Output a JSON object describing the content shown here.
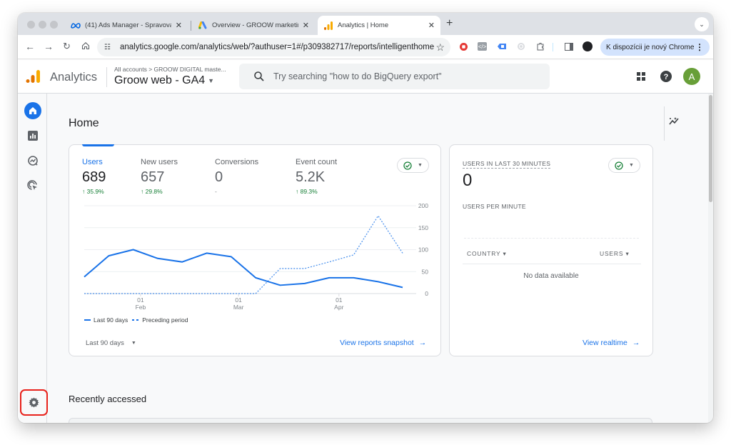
{
  "browser": {
    "tabs": [
      {
        "label": "(41) Ads Manager - Spravova",
        "icon": "meta-icon",
        "active": false
      },
      {
        "label": "Overview - GROOW marketing",
        "icon": "google-ads-icon",
        "active": false
      },
      {
        "label": "Analytics | Home",
        "icon": "analytics-icon",
        "active": true
      }
    ],
    "new_tab_label": "+",
    "url": "analytics.google.com/analytics/web/?authuser=1#/p309382717/reports/intelligenthome",
    "update_label": "K dispozícii je nový Chrome"
  },
  "header": {
    "app_name": "Analytics",
    "breadcrumb": "All accounts > GROOW DIGITAL maste...",
    "property": "Groow web - GA4",
    "search_placeholder": "Try searching \"how to do BigQuery export\"",
    "avatar_letter": "A"
  },
  "nav": {
    "items": [
      {
        "name": "home",
        "active": true
      },
      {
        "name": "reports",
        "active": false
      },
      {
        "name": "explore",
        "active": false
      },
      {
        "name": "advertising",
        "active": false
      }
    ],
    "settings_label": "Admin"
  },
  "main": {
    "title": "Home",
    "overview": {
      "metrics": [
        {
          "label": "Users",
          "value": "689",
          "change": "↑ 35.9%",
          "active": true
        },
        {
          "label": "New users",
          "value": "657",
          "change": "↑ 29.8%",
          "active": false
        },
        {
          "label": "Conversions",
          "value": "0",
          "change": "-",
          "active": false
        },
        {
          "label": "Event count",
          "value": "5.2K",
          "change": "↑ 89.3%",
          "active": false
        }
      ],
      "legend": {
        "current": "Last 90 days",
        "previous": "Preceding period"
      },
      "range": "Last 90 days",
      "link": "View reports snapshot",
      "link_arrow": "→"
    },
    "realtime": {
      "title": "USERS IN LAST 30 MINUTES",
      "value": "0",
      "subtitle": "USERS PER MINUTE",
      "col_country": "COUNTRY ▾",
      "col_users": "USERS ▾",
      "empty": "No data available",
      "link": "View realtime",
      "link_arrow": "→"
    },
    "recent_title": "Recently accessed"
  },
  "chart_data": {
    "type": "line",
    "title": "Users",
    "x_tick_labels": [
      {
        "day": "01",
        "month": "Feb",
        "index": 2.3
      },
      {
        "day": "01",
        "month": "Mar",
        "index": 6.3
      },
      {
        "day": "01",
        "month": "Apr",
        "index": 10.4
      }
    ],
    "y_ticks": [
      0,
      50,
      100,
      150,
      200
    ],
    "ylim": [
      0,
      200
    ],
    "series": [
      {
        "name": "Last 90 days",
        "style": "solid",
        "color": "#1a73e8",
        "values": [
          38,
          86,
          100,
          80,
          72,
          92,
          84,
          36,
          19,
          23,
          36,
          36,
          27,
          14
        ]
      },
      {
        "name": "Preceding period",
        "style": "dotted",
        "color": "#1a73e8",
        "values": [
          0,
          0,
          0,
          0,
          0,
          0,
          0,
          0,
          57,
          57,
          72,
          88,
          177,
          92
        ]
      }
    ],
    "legend_position": "bottom-left",
    "grid": true
  }
}
